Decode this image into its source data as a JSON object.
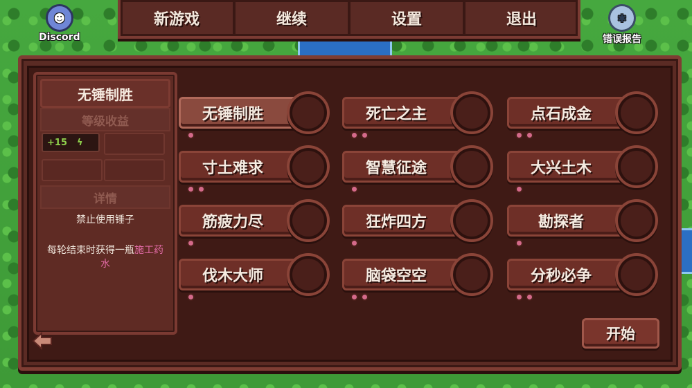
{
  "top_menu": {
    "new_game": "新游戏",
    "continue": "继续",
    "settings": "设置",
    "quit": "退出"
  },
  "corner": {
    "discord": "Discord",
    "bug_report": "错误报告"
  },
  "info": {
    "title": "无锤制胜",
    "reward_header": "等级收益",
    "reward_value": "+15",
    "details_header": "详情",
    "detail_1": "禁止使用锤子",
    "detail_2a": "每轮结束时获得一瓶",
    "detail_2b": "施工药水"
  },
  "mutators": [
    {
      "label": "无锤制胜",
      "dots": 1,
      "selected": true
    },
    {
      "label": "死亡之主",
      "dots": 2
    },
    {
      "label": "点石成金",
      "dots": 2
    },
    {
      "label": "寸土难求",
      "dots": 2
    },
    {
      "label": "智慧征途",
      "dots": 1
    },
    {
      "label": "大兴土木",
      "dots": 1
    },
    {
      "label": "筋疲力尽",
      "dots": 1
    },
    {
      "label": "狂炸四方",
      "dots": 1
    },
    {
      "label": "勘探者",
      "dots": 1
    },
    {
      "label": "伐木大师",
      "dots": 1
    },
    {
      "label": "脑袋空空",
      "dots": 2
    },
    {
      "label": "分秒必争",
      "dots": 2
    }
  ],
  "start_label": "开始",
  "colors": {
    "panel": "#5b2b24",
    "accent_pink": "#e06aa4",
    "reward_green": "#8fd04c"
  }
}
